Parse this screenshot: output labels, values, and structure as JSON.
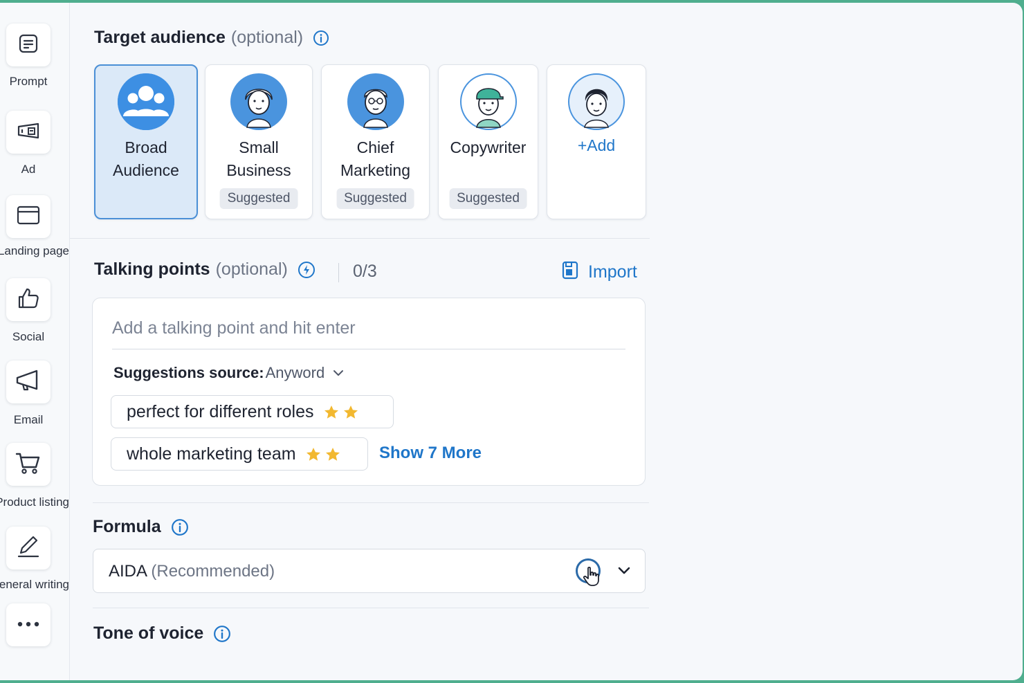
{
  "sidebar": {
    "items": [
      {
        "label": "Prompt",
        "icon": "prompt-icon"
      },
      {
        "label": "Ad",
        "icon": "ad-icon"
      },
      {
        "label": "Landing page",
        "icon": "landing-page-icon"
      },
      {
        "label": "Social",
        "icon": "thumbs-up-icon"
      },
      {
        "label": "Email",
        "icon": "megaphone-icon"
      },
      {
        "label": "Product listing",
        "icon": "cart-icon"
      },
      {
        "label": "General writing",
        "icon": "pen-icon"
      },
      {
        "label": "",
        "icon": "more-icon"
      }
    ]
  },
  "target_audience": {
    "title": "Target audience",
    "optional": "(optional)",
    "cards": [
      {
        "name": "Broad Audience",
        "selected": true,
        "badge": ""
      },
      {
        "name": "Small Business",
        "selected": false,
        "badge": "Suggested"
      },
      {
        "name": "Chief Marketing",
        "selected": false,
        "badge": "Suggested"
      },
      {
        "name": "Copywriter",
        "selected": false,
        "badge": "Suggested"
      }
    ],
    "add_label": "+Add"
  },
  "talking_points": {
    "title": "Talking points",
    "optional": "(optional)",
    "counter": "0/3",
    "import_label": "Import",
    "input_placeholder": "Add a talking point and hit enter",
    "suggestions_source_label": "Suggestions source:",
    "suggestions_source_value": "Anyword",
    "suggestions": [
      {
        "text": "perfect for different roles",
        "stars": 2
      },
      {
        "text": "whole marketing team",
        "stars": 2
      }
    ],
    "show_more_label": "Show 7 More"
  },
  "formula": {
    "title": "Formula",
    "value": "AIDA",
    "value_note": "(Recommended)"
  },
  "tone_of_voice": {
    "title": "Tone of voice"
  },
  "colors": {
    "accent": "#1f76c9",
    "selected_card_bg": "#dbe9f8",
    "star": "#f2b830",
    "frame_border": "#4fae8e"
  }
}
